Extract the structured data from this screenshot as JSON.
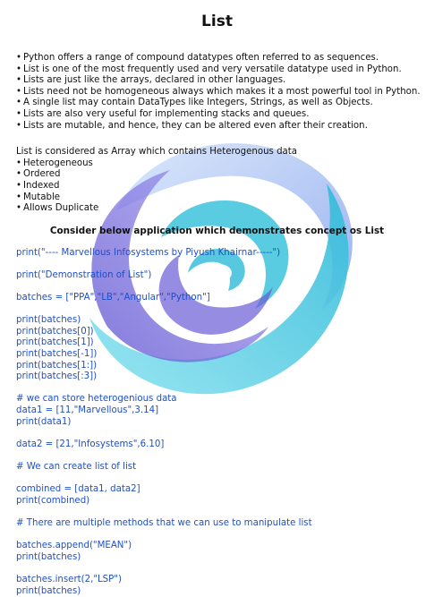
{
  "title": "List",
  "bullets": [
    "Python offers a range of compound datatypes often referred to as sequences.",
    "List is one of the most frequently used and very versatile datatype used in Python.",
    "Lists are just like the arrays, declared in other languages.",
    "Lists need not be homogeneous always which makes it a most powerful tool in Python.",
    "A single list may contain DataTypes like Integers, Strings, as well as Objects.",
    "Lists are also very useful for implementing stacks and queues.",
    "Lists are mutable, and hence, they can be altered even after their creation."
  ],
  "intro": "List is considered as Array which contains Heterogenous data",
  "properties": [
    "Heterogeneous",
    "Ordered",
    "Indexed",
    "Mutable",
    "Allows Duplicate"
  ],
  "section_heading": "Consider below application which demonstrates concept os List",
  "code_lines": [
    "print(\"---- Marvellous Infosystems by Piyush Khairnar-----\")",
    "",
    "print(\"Demonstration of List\")",
    "",
    "batches = [\"PPA\",\"LB\",\"Angular\",\"Python\"]",
    "",
    "print(batches)",
    "print(batches[0])",
    "print(batches[1])",
    "print(batches[-1])",
    "print(batches[1:])",
    "print(batches[:3])",
    "",
    "# we can store heterogenious data",
    "data1 = [11,\"Marvellous\",3.14]",
    "print(data1)",
    "",
    "data2 = [21,\"Infosystems\",6.10]",
    "",
    "# We can create list of list",
    "",
    "combined = [data1, data2]",
    "print(combined)",
    "",
    "# There are multiple methods that we can use to manipulate list",
    "",
    "batches.append(\"MEAN\")",
    "print(batches)",
    "",
    "batches.insert(2,\"LSP\")",
    "print(batches)"
  ],
  "watermark": {
    "icon": "swirl-logo-icon",
    "colors": [
      "#3cc3dd",
      "#6a5bd6",
      "#b9d6f5"
    ]
  }
}
